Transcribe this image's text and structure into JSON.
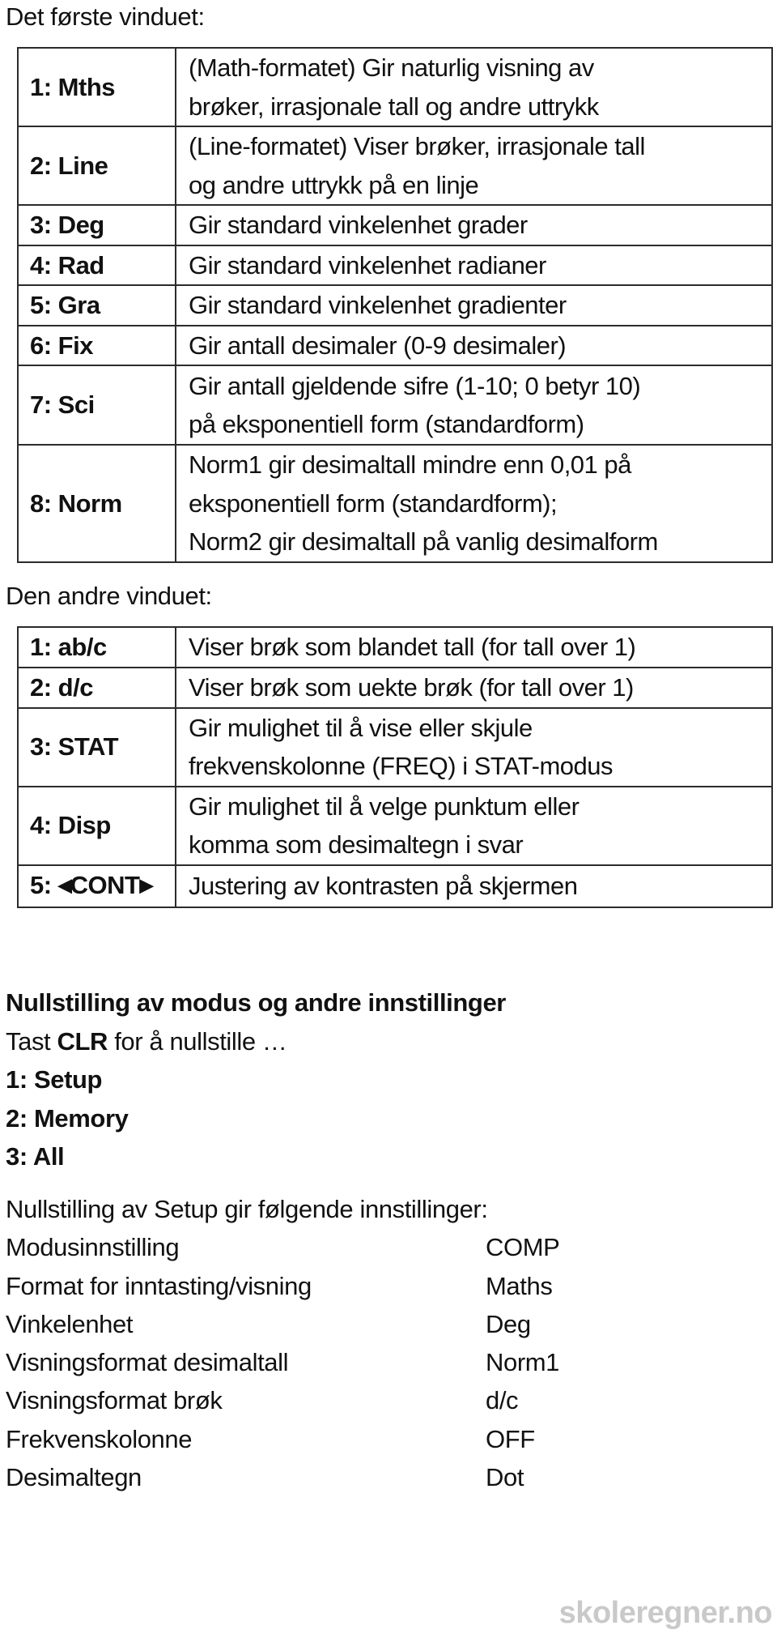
{
  "first_window": {
    "heading": "Det første vinduet:",
    "rows": [
      {
        "key": "1: Mths",
        "lines": [
          "(Math-formatet) Gir naturlig visning av",
          "brøker, irrasjonale tall og andre uttrykk"
        ]
      },
      {
        "key": "2: Line",
        "lines": [
          "(Line-formatet) Viser brøker, irrasjonale tall",
          "og andre uttrykk på en linje"
        ]
      },
      {
        "key": "3: Deg",
        "lines": [
          "Gir standard vinkelenhet grader"
        ]
      },
      {
        "key": "4: Rad",
        "lines": [
          "Gir standard vinkelenhet radianer"
        ]
      },
      {
        "key": "5: Gra",
        "lines": [
          "Gir standard vinkelenhet gradienter"
        ]
      },
      {
        "key": "6: Fix",
        "lines": [
          "Gir antall desimaler (0-9 desimaler)"
        ]
      },
      {
        "key": "7: Sci",
        "lines": [
          "Gir antall gjeldende sifre (1-10; 0 betyr 10)",
          "på eksponentiell form (standardform)"
        ]
      },
      {
        "key": "8: Norm",
        "lines": [
          "Norm1 gir desimaltall mindre enn 0,01 på",
          "eksponentiell form (standardform);",
          "Norm2 gir desimaltall på vanlig desimalform"
        ]
      }
    ]
  },
  "second_window": {
    "heading": "Den andre vinduet:",
    "rows": [
      {
        "key": "1: ab/c",
        "lines": [
          "Viser brøk som blandet tall (for tall over 1)"
        ]
      },
      {
        "key": "2: d/c",
        "lines": [
          "Viser brøk som uekte brøk (for tall over 1)"
        ]
      },
      {
        "key": "3: STAT",
        "lines": [
          "Gir mulighet til å vise eller skjule",
          "frekvenskolonne (FREQ) i STAT-modus"
        ]
      },
      {
        "key": "4: Disp",
        "lines": [
          "Gir mulighet til å velge punktum eller",
          "komma som desimaltegn i svar"
        ]
      },
      {
        "key_prefix": "5: ",
        "key_left_icon": "◀",
        "key_text": "CONT",
        "key_right_icon": "▶",
        "lines": [
          "Justering av kontrasten på skjermen"
        ]
      }
    ]
  },
  "reset": {
    "heading": "Nullstilling av modus og andre innstillinger",
    "instruction_prefix": "Tast ",
    "instruction_key": "CLR",
    "instruction_suffix": " for å nullstille …",
    "options": [
      "1: Setup",
      "2: Memory",
      "3: All"
    ]
  },
  "setup_defaults": {
    "heading": "Nullstilling av Setup gir følgende innstillinger:",
    "rows": [
      {
        "setting": "Modusinnstilling",
        "value": "COMP"
      },
      {
        "setting": "Format for inntasting/visning",
        "value": "Maths"
      },
      {
        "setting": "Vinkelenhet",
        "value": "Deg"
      },
      {
        "setting": "Visningsformat desimaltall",
        "value": "Norm1"
      },
      {
        "setting": "Visningsformat brøk",
        "value": "d/c"
      },
      {
        "setting": "Frekvenskolonne",
        "value": "OFF"
      },
      {
        "setting": "Desimaltegn",
        "value": "Dot"
      }
    ]
  },
  "watermark": "skoleregner.no"
}
